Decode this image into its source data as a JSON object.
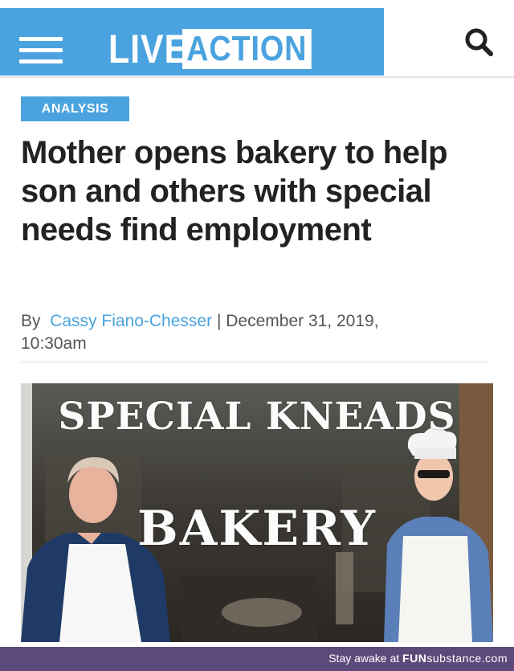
{
  "header": {
    "logo_live": "LIVE",
    "logo_action": "ACTION",
    "brand_color": "#4aa3df",
    "menu_icon": "hamburger-menu-icon",
    "search_icon": "search-icon"
  },
  "article": {
    "category_badge": "ANALYSIS",
    "headline": "Mother opens bakery to help son and others with special needs find employment",
    "byline": {
      "prefix": "By",
      "author": "Cassy Fiano-Chesser",
      "separator": "|",
      "date": "December 31, 2019",
      "date_suffix": ",",
      "time": "10:30am"
    }
  },
  "photo": {
    "sign_line1": "SPECIAL KNEADS",
    "sign_line2": "BAKERY"
  },
  "footer": {
    "tagline": "Stay awake at",
    "brand_fun": "FUN",
    "brand_substance": "substance",
    "brand_domain": ".com",
    "color": "#5e4a7a"
  }
}
